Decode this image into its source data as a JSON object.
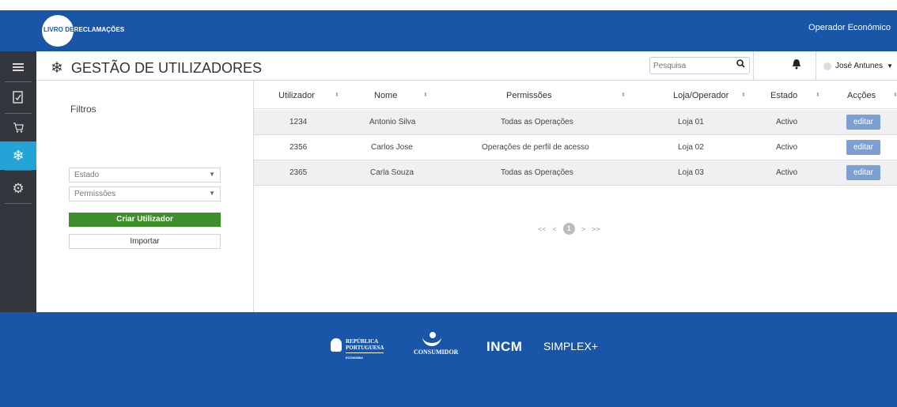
{
  "topbar": {
    "logo_part1": "LIVRO DE",
    "logo_part2": "RECLAMAÇÕES",
    "operator_label": "Operador Económico"
  },
  "sidebar": {
    "items": [
      {
        "icon": "menu-icon"
      },
      {
        "icon": "book-icon"
      },
      {
        "icon": "cart-icon"
      },
      {
        "icon": "snowflake-icon",
        "active": true
      },
      {
        "icon": "gear-icon"
      }
    ]
  },
  "header": {
    "title": "GESTÃO DE UTILIZADORES",
    "search_placeholder": "Pesquisa",
    "user_name": "José Antunes"
  },
  "filters": {
    "title": "Filtros",
    "estado_placeholder": "Estado",
    "permissoes_placeholder": "Permissões",
    "create_button": "Criar Utilizador",
    "import_button": "Importar"
  },
  "table": {
    "columns": [
      "Utilizador",
      "Nome",
      "Permissões",
      "Loja/Operador",
      "Estado",
      "Acções"
    ],
    "rows": [
      {
        "utilizador": "1234",
        "nome": "Antonio Silva",
        "permissoes": "Todas as Operações",
        "loja": "Loja 01",
        "estado": "Activo",
        "acao": "editar"
      },
      {
        "utilizador": "2356",
        "nome": "Carlos Jose",
        "permissoes": "Operações de perfil de acesso",
        "loja": "Loja 02",
        "estado": "Activo",
        "acao": "editar"
      },
      {
        "utilizador": "2365",
        "nome": "Carla Souza",
        "permissoes": "Todas as Operações",
        "loja": "Loja 03",
        "estado": "Activo",
        "acao": "editar"
      }
    ]
  },
  "pagination": {
    "first": "<<",
    "prev": "<",
    "current": "1",
    "next": ">",
    "last": ">>"
  },
  "footer": {
    "republica_line1": "REPÚBLICA",
    "republica_line2": "PORTUGUESA",
    "republica_sub": "ECONOMIA",
    "consumidor": "CONSUMIDOR",
    "incm": "INCM",
    "simplex": "SIMPLEX+"
  },
  "colors": {
    "brand_blue": "#1a56a8",
    "sidebar_dark": "#33363d",
    "active_cyan": "#23a3d6",
    "create_green": "#3d8f2a",
    "edit_blue": "#7e9fd3"
  }
}
